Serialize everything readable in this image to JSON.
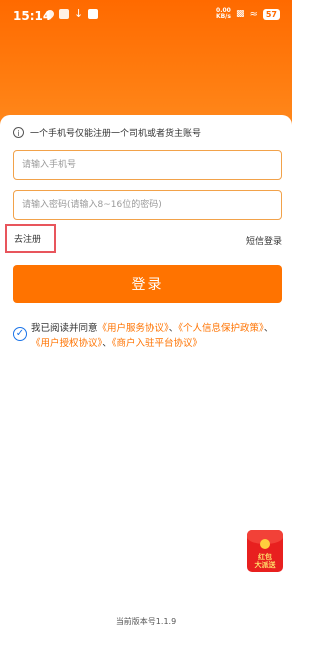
{
  "status_bar": {
    "time": "15:14",
    "net_speed_value": "0.00",
    "net_speed_unit": "KB/s",
    "battery": "57"
  },
  "notice_text": "一个手机号仅能注册一个司机或者货主账号",
  "phone_placeholder": "请输入手机号",
  "password_placeholder": "请输入密码(请输入8~16位的密码)",
  "register_link": "去注册",
  "sms_login_link": "短信登录",
  "login_button": "登录",
  "agreement": {
    "prefix": "我已阅读并同意",
    "link1": "《用户服务协议》",
    "sep1": "、",
    "link2": "《个人信息保护政策》",
    "sep2": "、",
    "link3": "《用户授权协议》",
    "sep3": "、",
    "link4": "《商户入驻平台协议》"
  },
  "redpacket": {
    "line1": "红包",
    "line2": "大派送"
  },
  "version": "当前版本号1.1.9",
  "colors": {
    "accent": "#ff7300",
    "header": "#ff6a00",
    "highlight_border": "#e8555c",
    "check": "#1a73e8"
  }
}
